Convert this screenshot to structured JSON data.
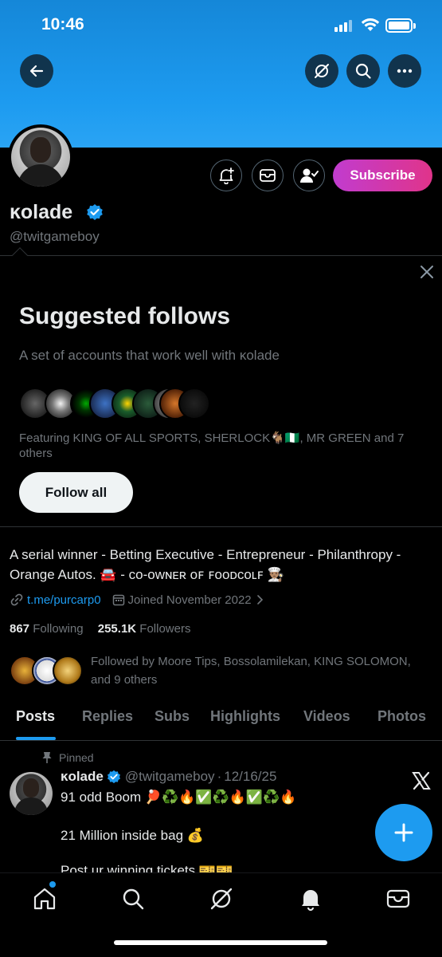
{
  "status_bar": {
    "time": "10:46"
  },
  "profile": {
    "display_name": "ĸolade",
    "handle": "@twitgameboy",
    "subscribe_label": "Subscribe",
    "bio": "A serial winner - Betting Executive - Entrepreneur - Philanthropy - Orange Autos. 🚘 - ᴄᴏ-ᴏᴡɴᴇʀ ᴏꜰ ꜰᴏᴏᴅᴄᴏʟꜰ 👨🏽‍🍳",
    "link": "t.me/purcarp0",
    "joined": "Joined November 2022",
    "following_count": "867",
    "following_label": "Following",
    "followers_count": "255.1K",
    "followers_label": "Followers",
    "followed_by": "Followed by Moore Tips, Bossolamilekan, KING SOLOMON, and 9 others"
  },
  "suggested": {
    "title": "Suggested follows",
    "subtitle": "A set of accounts that work well with ĸolade",
    "featuring": "Featuring KING OF ALL SPORTS, SHERLOCK🐐🇳🇬, MR GREEN and 7 others",
    "follow_all_label": "Follow all"
  },
  "tabs": [
    {
      "label": "Posts"
    },
    {
      "label": "Replies"
    },
    {
      "label": "Subs"
    },
    {
      "label": "Highlights"
    },
    {
      "label": "Videos"
    },
    {
      "label": "Photos"
    }
  ],
  "pinned_post": {
    "pinned_label": "Pinned",
    "author_name": "ĸolade",
    "author_handle": "@twitgameboy",
    "date": "12/16/25",
    "line1": "91 odd Boom 🏓♻️🔥✅♻️🔥✅♻️🔥",
    "line2": "21 Million inside bag 💰",
    "line3": "Post ur winning tickets 🎫🎫"
  },
  "icons": {
    "back": "back-arrow-icon",
    "grok": "grok-icon",
    "search": "search-icon",
    "more": "more-icon",
    "notify": "bell-plus-icon",
    "message": "envelope-icon",
    "following": "person-check-icon",
    "close": "close-icon",
    "link": "link-icon",
    "calendar": "calendar-icon",
    "chevron": "chevron-right-icon",
    "pin": "pin-icon",
    "x_logo": "x-logo-icon",
    "compose": "plus-icon",
    "nav_home": "home-icon",
    "nav_search": "search-icon",
    "nav_grok": "grok-icon",
    "nav_notifications": "bell-icon",
    "nav_messages": "envelope-icon"
  },
  "colors": {
    "banner": "#1d9bf0",
    "accent": "#1d9bf0",
    "subscribe_gradient_start": "#c13ccf",
    "subscribe_gradient_end": "#e0348a",
    "background": "#000000",
    "muted_text": "#71767b"
  }
}
